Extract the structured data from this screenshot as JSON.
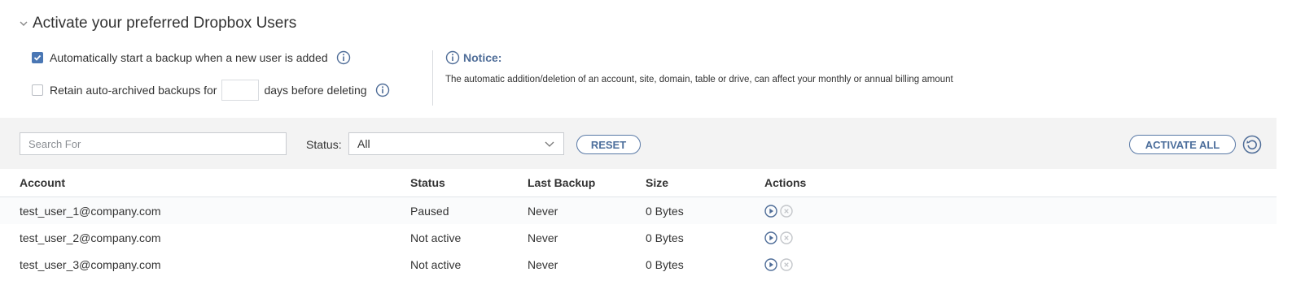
{
  "section": {
    "title": "Activate your preferred Dropbox Users",
    "collapse_icon": "chevron-down-icon"
  },
  "options": {
    "auto_backup": {
      "label": "Automatically start a backup when a new user is added",
      "checked": true,
      "icon": "info-icon"
    },
    "retain": {
      "label_before": "Retain auto-archived backups for",
      "days_value": "",
      "label_after": "days before deleting",
      "checked": false,
      "icon": "info-icon"
    }
  },
  "notice": {
    "title": "Notice:",
    "text": "The automatic addition/deletion of an account, site, domain, table or drive, can affect your monthly or annual billing amount"
  },
  "filters": {
    "search_placeholder": "Search For",
    "status_label": "Status:",
    "status_value": "All",
    "reset_label": "RESET",
    "activate_all_label": "ACTIVATE ALL",
    "refresh_icon": "refresh-icon"
  },
  "table": {
    "headers": {
      "account": "Account",
      "status": "Status",
      "last_backup": "Last Backup",
      "size": "Size",
      "actions": "Actions"
    },
    "rows": [
      {
        "account": "test_user_1@company.com",
        "status": "Paused",
        "last_backup": "Never",
        "size": "0 Bytes"
      },
      {
        "account": "test_user_2@company.com",
        "status": "Not active",
        "last_backup": "Never",
        "size": "0 Bytes"
      },
      {
        "account": "test_user_3@company.com",
        "status": "Not active",
        "last_backup": "Never",
        "size": "0 Bytes"
      }
    ],
    "row_action_icons": [
      "play-icon",
      "cancel-icon"
    ]
  },
  "colors": {
    "accent": "#4a77b4",
    "button_text": "#4d6f9c",
    "filter_bar_bg": "#f3f3f3"
  }
}
